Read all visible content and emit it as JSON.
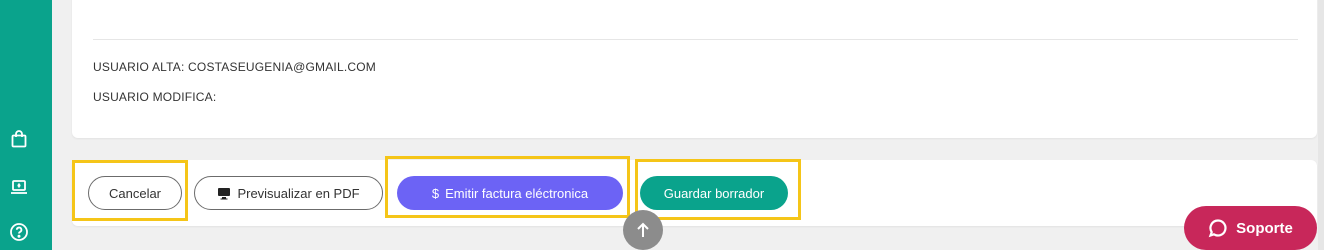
{
  "record_info": {
    "created_by": "USUARIO ALTA: COSTASEUGENIA@GMAIL.COM",
    "modified_by": "USUARIO MODIFICA:"
  },
  "actions": {
    "cancel_label": "Cancelar",
    "preview_label": "Previsualizar en PDF",
    "emit_label": "Emitir factura eléctronica",
    "emit_icon_glyph": "$",
    "save_draft_label": "Guardar borrador"
  },
  "support": {
    "label": "Soporte"
  },
  "sidebar": {
    "icons": [
      "shopping-bag-icon",
      "laptop-icon",
      "help-circle-icon"
    ]
  },
  "colors": {
    "brand_teal": "#0aa38c",
    "primary_purple": "#6c63f5",
    "support_magenta": "#c8275a",
    "highlight_yellow": "#f5c518"
  }
}
